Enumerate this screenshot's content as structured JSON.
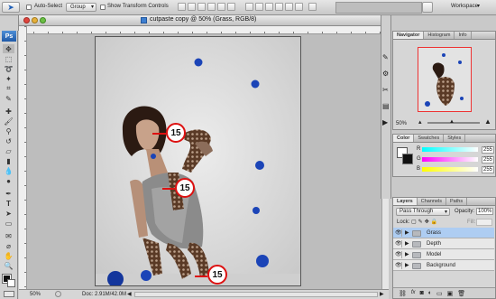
{
  "options_bar": {
    "auto_select_label": "Auto-Select",
    "auto_select_value": "Group",
    "show_transform_label": "Show Transform Controls",
    "workspace_label": "Workspace"
  },
  "toolbox": {
    "logo": "Ps"
  },
  "document": {
    "title": "cutpaste copy @ 50% (Grass, RGB/8)",
    "zoom": "50%",
    "doc_size": "Doc: 2.91M/42.0M",
    "badges": [
      "15",
      "15",
      "15"
    ]
  },
  "navigator": {
    "tabs": [
      "Navigator",
      "Histogram",
      "Info"
    ],
    "zoom": "50%"
  },
  "color_panel": {
    "tabs": [
      "Color",
      "Swatches",
      "Styles"
    ],
    "channels": [
      {
        "label": "R",
        "value": "255"
      },
      {
        "label": "G",
        "value": "255"
      },
      {
        "label": "B",
        "value": "255"
      }
    ]
  },
  "layers_panel": {
    "tabs": [
      "Layers",
      "Channels",
      "Paths"
    ],
    "blend_mode": "Pass Through",
    "opacity_label": "Opacity:",
    "opacity_value": "100%",
    "lock_label": "Lock:",
    "fill_label": "Fill:",
    "layers": [
      {
        "name": "Grass",
        "selected": true
      },
      {
        "name": "Depth",
        "selected": false
      },
      {
        "name": "Model",
        "selected": false
      },
      {
        "name": "Background",
        "selected": false
      }
    ]
  },
  "colors": {
    "accent": "#b3d1f5",
    "selection": "#aecdf2",
    "badge_ring": "#dd1111",
    "splat": "#1b44b7"
  }
}
